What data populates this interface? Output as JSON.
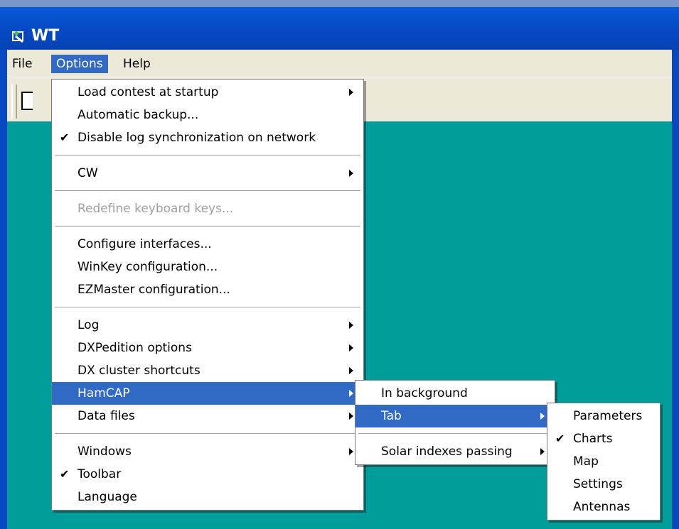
{
  "window": {
    "title": "WT"
  },
  "menubar": [
    {
      "label": "File",
      "active": false
    },
    {
      "label": "Options",
      "active": true
    },
    {
      "label": "Help",
      "active": false
    }
  ],
  "options_menu": {
    "load_contest": "Load contest at startup",
    "automatic_backup": "Automatic backup...",
    "disable_log_sync": "Disable log synchronization on network",
    "cw": "CW",
    "redefine_keys": "Redefine keyboard keys...",
    "configure_interfaces": "Configure interfaces...",
    "winkey_config": "WinKey configuration...",
    "ezmaster_config": "EZMaster configuration...",
    "log": "Log",
    "dxpedition_options": "DXPedition options",
    "dx_cluster_shortcuts": "DX cluster shortcuts",
    "hamcap": "HamCAP",
    "data_files": "Data files",
    "windows": "Windows",
    "toolbar": "Toolbar",
    "language": "Language"
  },
  "hamcap_menu": {
    "in_background": "In background",
    "tab": "Tab",
    "solar_indexes": "Solar indexes passing"
  },
  "tab_menu": {
    "parameters": "Parameters",
    "charts": "Charts",
    "map": "Map",
    "settings": "Settings",
    "antennas": "Antennas"
  },
  "glyphs": {
    "check": "✔"
  },
  "colors": {
    "titlebar": "#0548c0",
    "menu_highlight": "#316ac5",
    "client_background": "#009d9a",
    "menu_face": "#ece9d8"
  }
}
